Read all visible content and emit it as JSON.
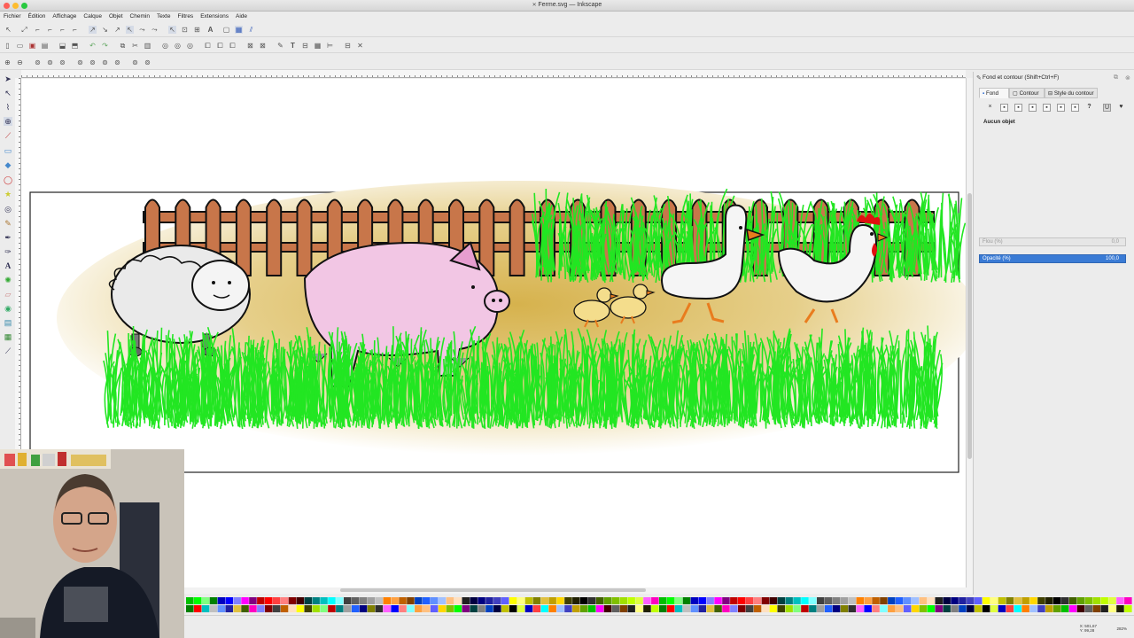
{
  "window": {
    "title": "Ferme.svg — Inkscape",
    "traffic_colors": [
      "#fd5f57",
      "#fdbc2e",
      "#28c940"
    ]
  },
  "menu": [
    "Fichier",
    "Édition",
    "Affichage",
    "Calque",
    "Objet",
    "Chemin",
    "Texte",
    "Filtres",
    "Extensions",
    "Aide"
  ],
  "toolbars": {
    "snap_icons": [
      "select-arrow-icon",
      "node-icon",
      "snap-icon",
      "snap-icon",
      "snap-icon",
      "snap-icon",
      "snap-icon",
      "snap-icon",
      "grid-icon",
      "guide-icon"
    ],
    "command_icons": [
      "new-icon",
      "open-icon",
      "save-icon",
      "print-icon",
      "import-icon",
      "export-icon",
      "undo-icon",
      "redo-icon",
      "copy-icon",
      "cut-icon",
      "paste-icon",
      "zoom-icon",
      "zoom-icon",
      "zoom-icon",
      "duplicate-icon",
      "clone-icon",
      "unlink-icon",
      "group-icon",
      "ungroup-icon",
      "fill-icon",
      "text-icon",
      "layers-icon",
      "xml-icon",
      "align-icon",
      "preferences-icon"
    ],
    "zoom_icons": [
      "zoom-in-icon",
      "zoom-out-icon",
      "zoom-1-icon",
      "zoom-fit-icon",
      "zoom-drawing-icon",
      "zoom-page-icon",
      "zoom-width-icon"
    ]
  },
  "tools": [
    "select-tool-icon",
    "node-tool-icon",
    "tweak-tool-icon",
    "zoom-tool-icon",
    "measure-tool-icon",
    "rect-tool-icon",
    "3dbox-tool-icon",
    "ellipse-tool-icon",
    "star-tool-icon",
    "spiral-tool-icon",
    "pencil-tool-icon",
    "pen-tool-icon",
    "calligraphy-tool-icon",
    "text-tool-icon",
    "spray-tool-icon",
    "eraser-tool-icon",
    "bucket-tool-icon",
    "gradient-tool-icon",
    "mesh-tool-icon",
    "dropper-tool-icon"
  ],
  "dock": {
    "title": "Fond et contour (Shift+Ctrl+F)",
    "tabs": [
      "Fond",
      "Contour",
      "Style du contour"
    ],
    "paint_buttons": [
      "×",
      "▪",
      "▪",
      "▪",
      "▪",
      "▪",
      "▪",
      "?",
      "U",
      "♥"
    ],
    "no_object": "Aucun objet",
    "blur_label": "Flou (%)",
    "blur_value": "0,0",
    "opacity_label": "Opacité (%)",
    "opacity_value": "100,0"
  },
  "status": {
    "coords_x": "X: 501,67",
    "coords_y": "Y: 99,28",
    "zoom": "282%"
  },
  "colors": {
    "grass": "#22e622",
    "fence": "#c8764a",
    "pig": "#f2c6e4",
    "ground": "#d8be6a"
  }
}
